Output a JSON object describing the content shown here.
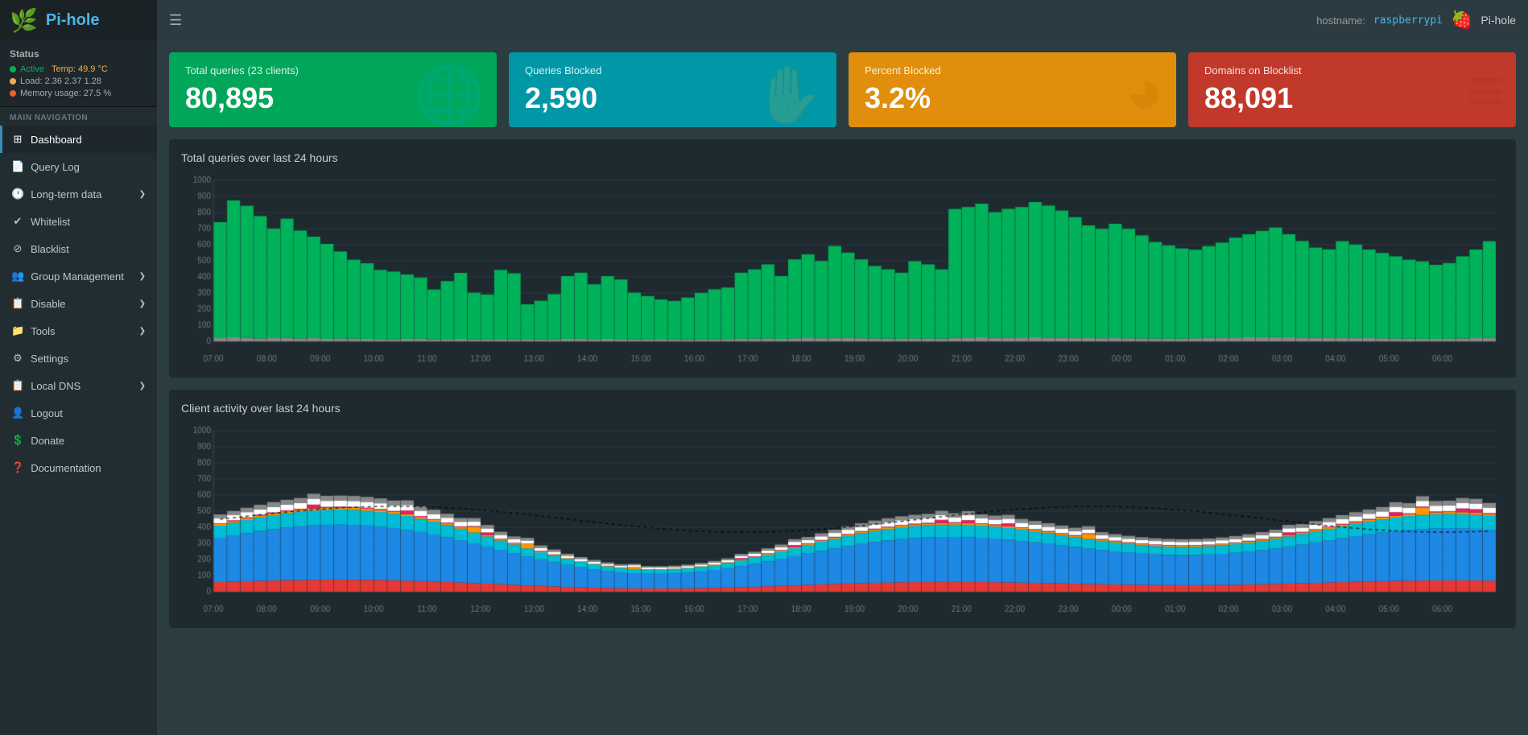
{
  "topbar": {
    "menu_icon": "☰",
    "hostname_label": "hostname:",
    "hostname_value": "raspberrypi",
    "pi_icon": "🍓",
    "app_name": "Pi-hole"
  },
  "sidebar": {
    "title": "Pi-hole",
    "logo": "🍃",
    "status": {
      "label": "Status",
      "active_label": "Active",
      "temp_label": "Temp: 49.9 °C",
      "load_label": "Load: 2.36  2.37  1.28",
      "memory_label": "Memory usage: 27.5 %"
    },
    "nav_section": "MAIN NAVIGATION",
    "items": [
      {
        "id": "dashboard",
        "label": "Dashboard",
        "icon": "⊞",
        "active": true
      },
      {
        "id": "query-log",
        "label": "Query Log",
        "icon": "📄",
        "active": false
      },
      {
        "id": "long-term",
        "label": "Long-term data",
        "icon": "🕐",
        "active": false,
        "has_chevron": true
      },
      {
        "id": "whitelist",
        "label": "Whitelist",
        "icon": "✅",
        "active": false
      },
      {
        "id": "blacklist",
        "label": "Blacklist",
        "icon": "🚫",
        "active": false
      },
      {
        "id": "group-mgmt",
        "label": "Group Management",
        "icon": "👥",
        "active": false,
        "has_chevron": true
      },
      {
        "id": "disable",
        "label": "Disable",
        "icon": "📋",
        "active": false,
        "has_chevron": true
      },
      {
        "id": "tools",
        "label": "Tools",
        "icon": "📁",
        "active": false,
        "has_chevron": true
      },
      {
        "id": "settings",
        "label": "Settings",
        "icon": "⚙",
        "active": false
      },
      {
        "id": "local-dns",
        "label": "Local DNS",
        "icon": "📋",
        "active": false,
        "has_chevron": true
      },
      {
        "id": "logout",
        "label": "Logout",
        "icon": "👤",
        "active": false
      },
      {
        "id": "donate",
        "label": "Donate",
        "icon": "💲",
        "active": false
      },
      {
        "id": "documentation",
        "label": "Documentation",
        "icon": "❓",
        "active": false
      }
    ]
  },
  "stats": [
    {
      "id": "total-queries",
      "label": "Total queries (23 clients)",
      "value": "80,895",
      "color": "green",
      "icon": "🌐"
    },
    {
      "id": "queries-blocked",
      "label": "Queries Blocked",
      "value": "2,590",
      "color": "blue",
      "icon": "✋"
    },
    {
      "id": "percent-blocked",
      "label": "Percent Blocked",
      "value": "3.2%",
      "color": "orange",
      "icon": "🥧"
    },
    {
      "id": "domains-blocklist",
      "label": "Domains on Blocklist",
      "value": "88,091",
      "color": "red",
      "icon": "📋"
    }
  ],
  "charts": {
    "queries_title": "Total queries over last 24 hours",
    "client_title": "Client activity over last 24 hours",
    "y_labels": [
      "0",
      "100",
      "200",
      "300",
      "400",
      "500",
      "600",
      "700",
      "800",
      "900",
      "1000"
    ],
    "x_labels": [
      "07:00",
      "08:00",
      "09:00",
      "10:00",
      "11:00",
      "12:00",
      "13:00",
      "14:00",
      "15:00",
      "16:00",
      "17:00",
      "18:00",
      "19:00",
      "20:00",
      "21:00",
      "22:00",
      "23:00",
      "00:00",
      "01:00",
      "02:00",
      "03:00",
      "04:00",
      "05:00",
      "06:00"
    ]
  }
}
